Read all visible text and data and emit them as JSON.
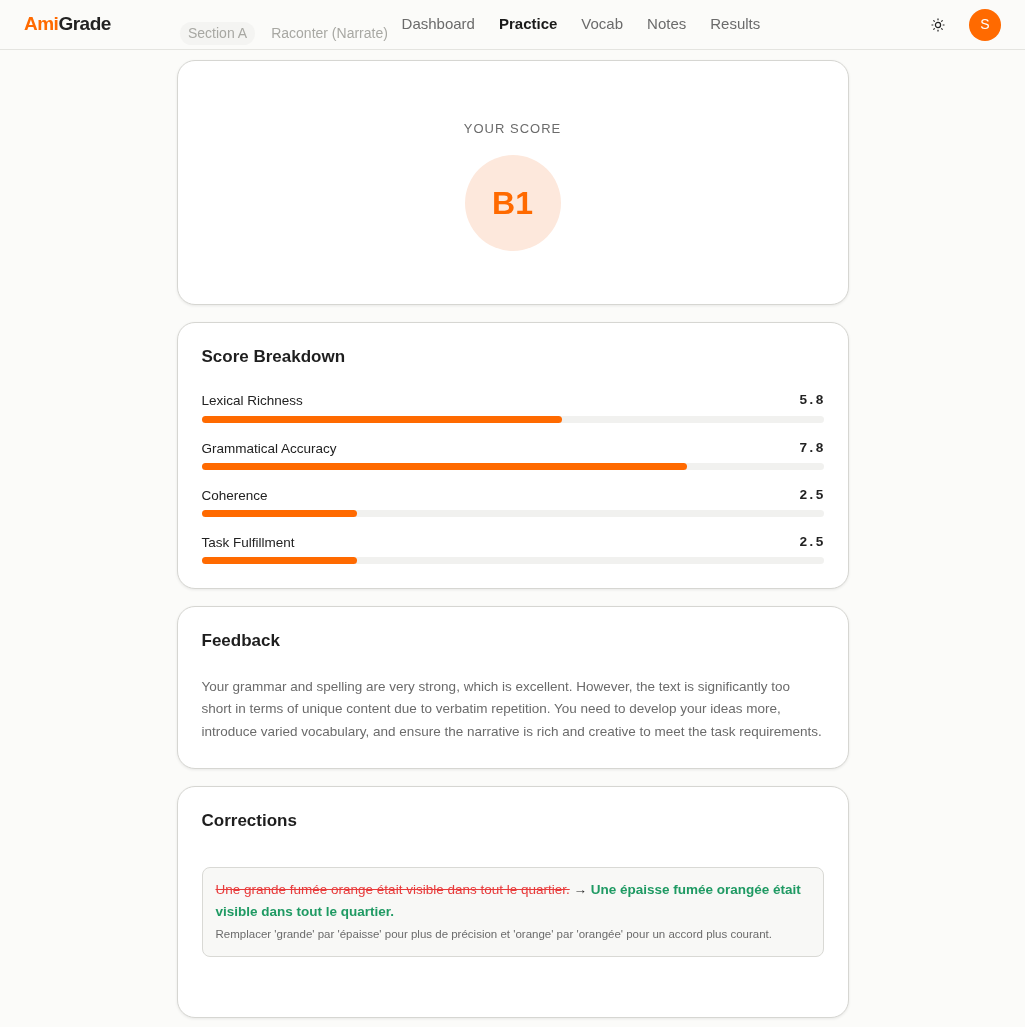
{
  "brand": {
    "accent": "Ami",
    "rest": "Grade"
  },
  "nav": [
    {
      "label": "Dashboard",
      "selected": false
    },
    {
      "label": "Practice",
      "selected": true
    },
    {
      "label": "Vocab",
      "selected": false
    },
    {
      "label": "Notes",
      "selected": false
    },
    {
      "label": "Results",
      "selected": false
    }
  ],
  "behind_header": {
    "section": "Section A",
    "title": "Raconter (Narrate)"
  },
  "avatar": "S",
  "score": {
    "label": "YOUR SCORE",
    "grade": "B1"
  },
  "breakdown": {
    "title": "Score Breakdown",
    "criteria": [
      {
        "name": "Lexical Richness",
        "reading": "5.8",
        "level": 0.58
      },
      {
        "name": "Grammatical Accuracy",
        "reading": "7.8",
        "level": 0.78
      },
      {
        "name": "Coherence",
        "reading": "2.5",
        "level": 0.25
      },
      {
        "name": "Task Fulfillment",
        "reading": "2.5",
        "level": 0.25
      }
    ]
  },
  "feedback": {
    "title": "Feedback",
    "text": "Your grammar and spelling are very strong, which is excellent. However, the text is significantly too short in terms of unique content due to verbatim repetition. You need to develop your ideas more, introduce varied vocabulary, and ensure the narrative is rich and creative to meet the task requirements."
  },
  "corrections": {
    "title": "Corrections",
    "items": [
      {
        "original": "Une grande fumée orange était visible dans tout le quartier.",
        "arrow": "→",
        "corrected": "Une épaisse fumée orangée était visible dans tout le quartier.",
        "explanation": "Remplacer 'grande' par 'épaisse' pour plus de précision et 'orange' par 'orangée' pour un accord plus courant."
      }
    ]
  }
}
